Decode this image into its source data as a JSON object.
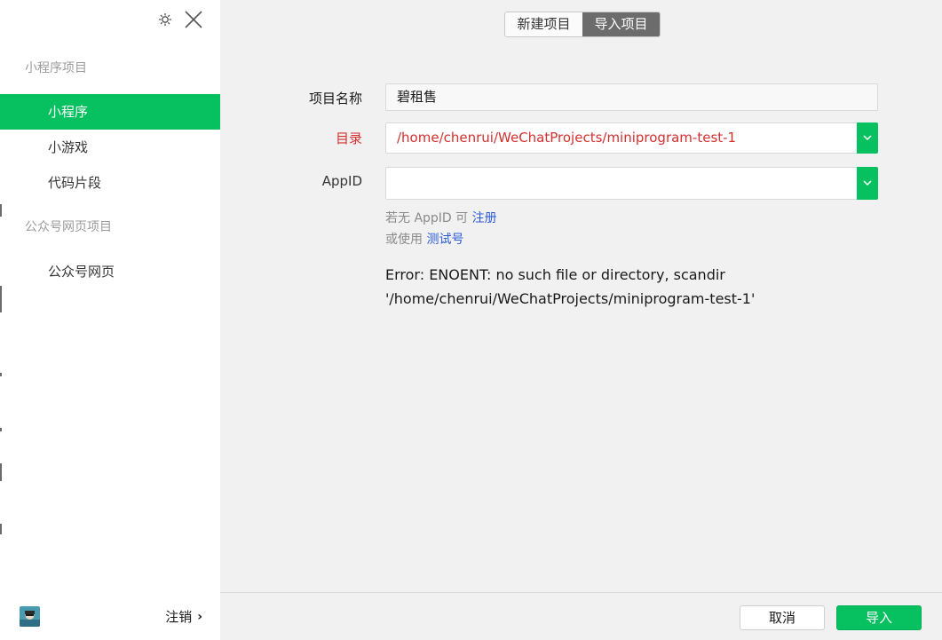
{
  "sidebar": {
    "sections": [
      {
        "title": "小程序项目"
      },
      {
        "title": "公众号网页项目"
      }
    ],
    "items": [
      {
        "label": "小程序"
      },
      {
        "label": "小游戏"
      },
      {
        "label": "代码片段"
      },
      {
        "label": "公众号网页"
      }
    ],
    "logout_label": "注销"
  },
  "tabs": [
    {
      "label": "新建项目"
    },
    {
      "label": "导入项目"
    }
  ],
  "form": {
    "project_name_label": "项目名称",
    "project_name_value": "碧租售",
    "directory_label": "目录",
    "directory_value": "/home/chenrui/WeChatProjects/miniprogram-test-1",
    "appid_label": "AppID",
    "appid_value": "",
    "hint_no_appid": "若无 AppID 可",
    "hint_register": "注册",
    "hint_or_use": "或使用",
    "hint_test_account": "测试号"
  },
  "error": {
    "line1": "Error: ENOENT: no such file or directory, scandir",
    "line2": "'/home/chenrui/WeChatProjects/miniprogram-test-1'"
  },
  "footer": {
    "cancel_label": "取消",
    "import_label": "导入"
  },
  "colors": {
    "accent": "#07c160",
    "error": "#d43030",
    "link": "#2a5bd7"
  },
  "icons": [
    "gear-icon",
    "close-icon",
    "chevron-down-icon",
    "avatar",
    "chevron-right-icon"
  ]
}
